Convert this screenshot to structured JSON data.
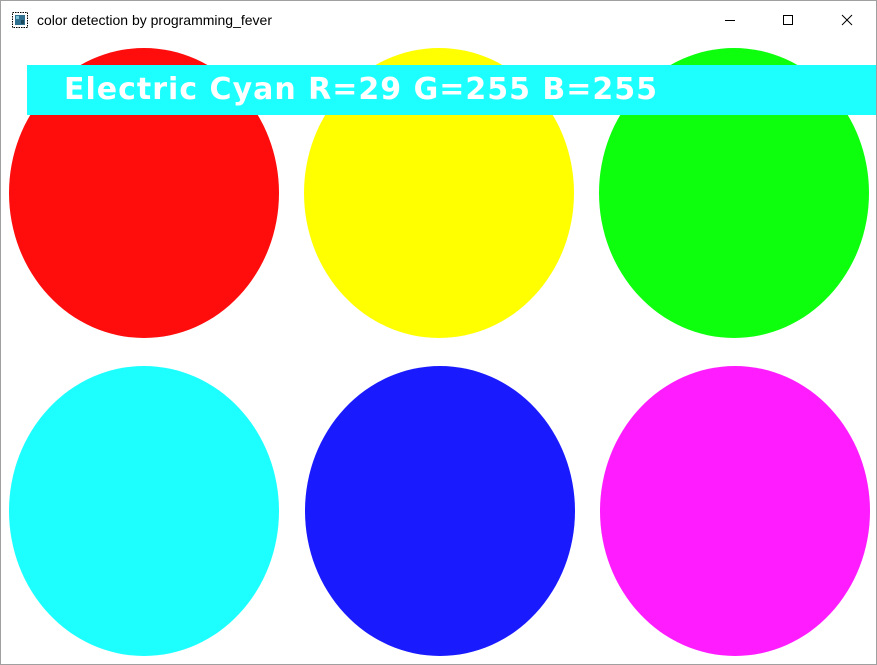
{
  "window": {
    "title": "color detection by programming_fever",
    "icons": {
      "app": "app-window-icon",
      "minimize": "minimize-icon",
      "maximize": "maximize-icon",
      "close": "close-icon"
    }
  },
  "circles": [
    {
      "name": "red",
      "color": "#ff0d0d"
    },
    {
      "name": "yellow",
      "color": "#ffff00"
    },
    {
      "name": "green",
      "color": "#0dff0d"
    },
    {
      "name": "cyan",
      "color": "#1dffff"
    },
    {
      "name": "blue",
      "color": "#1a1aff"
    },
    {
      "name": "magenta",
      "color": "#ff1dff"
    }
  ],
  "detection": {
    "text": "Electric Cyan R=29 G=255 B=255",
    "banner_color": "#1dffff",
    "text_color": "#ffffff"
  }
}
